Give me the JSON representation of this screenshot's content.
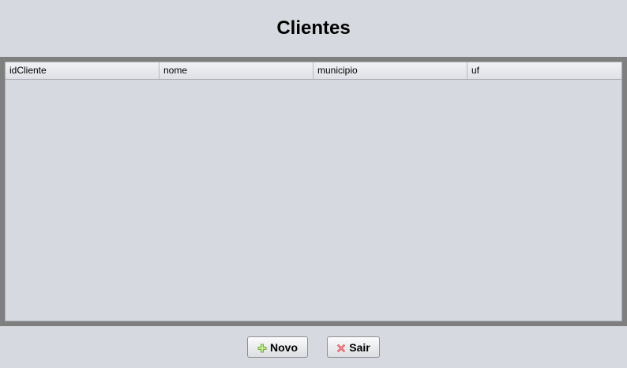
{
  "window": {
    "title": "Clientes"
  },
  "table": {
    "columns": [
      "idCliente",
      "nome",
      "municipio",
      "uf"
    ],
    "rows": []
  },
  "buttons": {
    "novo": {
      "label": "Novo",
      "icon": "plus-icon",
      "icon_color": "#6fae2e"
    },
    "sair": {
      "label": "Sair",
      "icon": "x-icon",
      "icon_color": "#d9434b"
    }
  },
  "colors": {
    "background": "#d6d9df",
    "frame": "#7f7f7f"
  }
}
